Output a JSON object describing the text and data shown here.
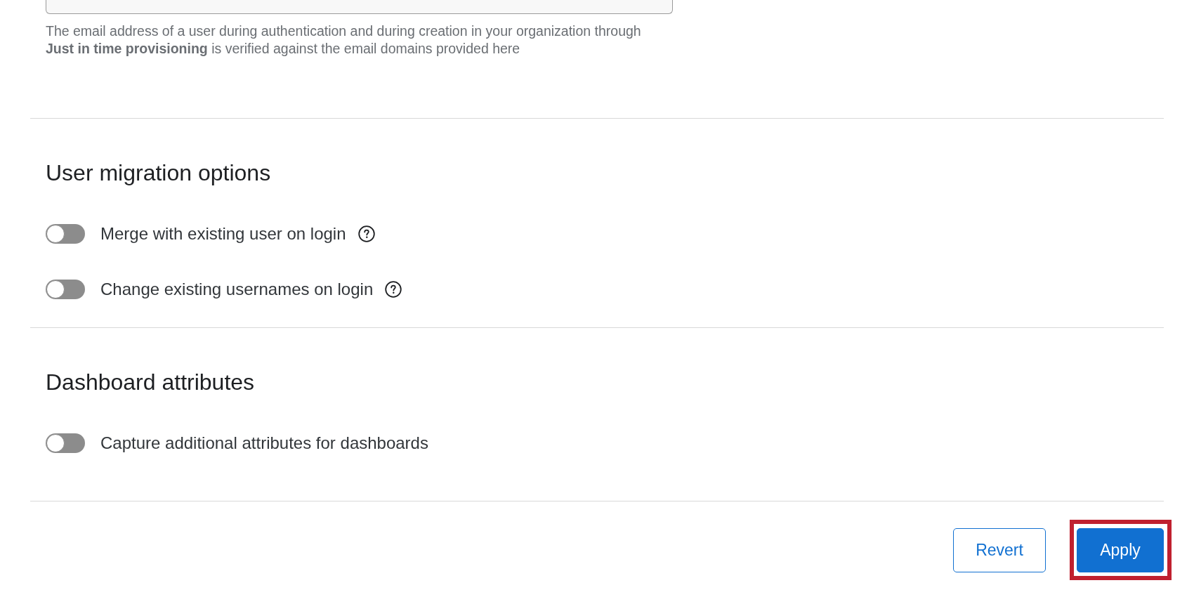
{
  "email_domains": {
    "help_text": "The email address of a user during authentication and during creation in your organization through **Just in time provisioning** is verified against the email domains provided here"
  },
  "sections": [
    {
      "title": "User migration options",
      "toggles": [
        {
          "label": "Merge with existing user on login",
          "on": false,
          "help": true
        },
        {
          "label": "Change existing usernames on login",
          "on": false,
          "help": true
        }
      ]
    },
    {
      "title": "Dashboard attributes",
      "toggles": [
        {
          "label": "Capture additional attributes for dashboards",
          "on": false,
          "help": false
        }
      ]
    }
  ],
  "footer_buttons": [
    {
      "label": "Revert",
      "kind": "secondary",
      "highlighted": false
    },
    {
      "label": "Apply",
      "kind": "primary",
      "highlighted": true
    }
  ]
}
